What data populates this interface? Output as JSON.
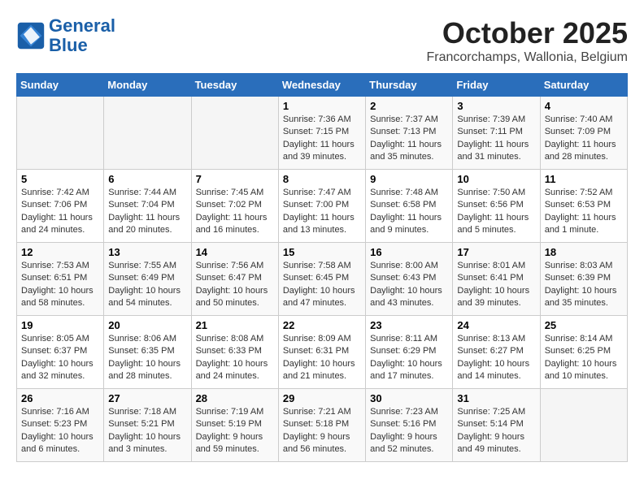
{
  "header": {
    "logo_line1": "General",
    "logo_line2": "Blue",
    "month": "October 2025",
    "location": "Francorchamps, Wallonia, Belgium"
  },
  "weekdays": [
    "Sunday",
    "Monday",
    "Tuesday",
    "Wednesday",
    "Thursday",
    "Friday",
    "Saturday"
  ],
  "weeks": [
    [
      {
        "day": "",
        "sunrise": "",
        "sunset": "",
        "daylight": ""
      },
      {
        "day": "",
        "sunrise": "",
        "sunset": "",
        "daylight": ""
      },
      {
        "day": "",
        "sunrise": "",
        "sunset": "",
        "daylight": ""
      },
      {
        "day": "1",
        "sunrise": "Sunrise: 7:36 AM",
        "sunset": "Sunset: 7:15 PM",
        "daylight": "Daylight: 11 hours and 39 minutes."
      },
      {
        "day": "2",
        "sunrise": "Sunrise: 7:37 AM",
        "sunset": "Sunset: 7:13 PM",
        "daylight": "Daylight: 11 hours and 35 minutes."
      },
      {
        "day": "3",
        "sunrise": "Sunrise: 7:39 AM",
        "sunset": "Sunset: 7:11 PM",
        "daylight": "Daylight: 11 hours and 31 minutes."
      },
      {
        "day": "4",
        "sunrise": "Sunrise: 7:40 AM",
        "sunset": "Sunset: 7:09 PM",
        "daylight": "Daylight: 11 hours and 28 minutes."
      }
    ],
    [
      {
        "day": "5",
        "sunrise": "Sunrise: 7:42 AM",
        "sunset": "Sunset: 7:06 PM",
        "daylight": "Daylight: 11 hours and 24 minutes."
      },
      {
        "day": "6",
        "sunrise": "Sunrise: 7:44 AM",
        "sunset": "Sunset: 7:04 PM",
        "daylight": "Daylight: 11 hours and 20 minutes."
      },
      {
        "day": "7",
        "sunrise": "Sunrise: 7:45 AM",
        "sunset": "Sunset: 7:02 PM",
        "daylight": "Daylight: 11 hours and 16 minutes."
      },
      {
        "day": "8",
        "sunrise": "Sunrise: 7:47 AM",
        "sunset": "Sunset: 7:00 PM",
        "daylight": "Daylight: 11 hours and 13 minutes."
      },
      {
        "day": "9",
        "sunrise": "Sunrise: 7:48 AM",
        "sunset": "Sunset: 6:58 PM",
        "daylight": "Daylight: 11 hours and 9 minutes."
      },
      {
        "day": "10",
        "sunrise": "Sunrise: 7:50 AM",
        "sunset": "Sunset: 6:56 PM",
        "daylight": "Daylight: 11 hours and 5 minutes."
      },
      {
        "day": "11",
        "sunrise": "Sunrise: 7:52 AM",
        "sunset": "Sunset: 6:53 PM",
        "daylight": "Daylight: 11 hours and 1 minute."
      }
    ],
    [
      {
        "day": "12",
        "sunrise": "Sunrise: 7:53 AM",
        "sunset": "Sunset: 6:51 PM",
        "daylight": "Daylight: 10 hours and 58 minutes."
      },
      {
        "day": "13",
        "sunrise": "Sunrise: 7:55 AM",
        "sunset": "Sunset: 6:49 PM",
        "daylight": "Daylight: 10 hours and 54 minutes."
      },
      {
        "day": "14",
        "sunrise": "Sunrise: 7:56 AM",
        "sunset": "Sunset: 6:47 PM",
        "daylight": "Daylight: 10 hours and 50 minutes."
      },
      {
        "day": "15",
        "sunrise": "Sunrise: 7:58 AM",
        "sunset": "Sunset: 6:45 PM",
        "daylight": "Daylight: 10 hours and 47 minutes."
      },
      {
        "day": "16",
        "sunrise": "Sunrise: 8:00 AM",
        "sunset": "Sunset: 6:43 PM",
        "daylight": "Daylight: 10 hours and 43 minutes."
      },
      {
        "day": "17",
        "sunrise": "Sunrise: 8:01 AM",
        "sunset": "Sunset: 6:41 PM",
        "daylight": "Daylight: 10 hours and 39 minutes."
      },
      {
        "day": "18",
        "sunrise": "Sunrise: 8:03 AM",
        "sunset": "Sunset: 6:39 PM",
        "daylight": "Daylight: 10 hours and 35 minutes."
      }
    ],
    [
      {
        "day": "19",
        "sunrise": "Sunrise: 8:05 AM",
        "sunset": "Sunset: 6:37 PM",
        "daylight": "Daylight: 10 hours and 32 minutes."
      },
      {
        "day": "20",
        "sunrise": "Sunrise: 8:06 AM",
        "sunset": "Sunset: 6:35 PM",
        "daylight": "Daylight: 10 hours and 28 minutes."
      },
      {
        "day": "21",
        "sunrise": "Sunrise: 8:08 AM",
        "sunset": "Sunset: 6:33 PM",
        "daylight": "Daylight: 10 hours and 24 minutes."
      },
      {
        "day": "22",
        "sunrise": "Sunrise: 8:09 AM",
        "sunset": "Sunset: 6:31 PM",
        "daylight": "Daylight: 10 hours and 21 minutes."
      },
      {
        "day": "23",
        "sunrise": "Sunrise: 8:11 AM",
        "sunset": "Sunset: 6:29 PM",
        "daylight": "Daylight: 10 hours and 17 minutes."
      },
      {
        "day": "24",
        "sunrise": "Sunrise: 8:13 AM",
        "sunset": "Sunset: 6:27 PM",
        "daylight": "Daylight: 10 hours and 14 minutes."
      },
      {
        "day": "25",
        "sunrise": "Sunrise: 8:14 AM",
        "sunset": "Sunset: 6:25 PM",
        "daylight": "Daylight: 10 hours and 10 minutes."
      }
    ],
    [
      {
        "day": "26",
        "sunrise": "Sunrise: 7:16 AM",
        "sunset": "Sunset: 5:23 PM",
        "daylight": "Daylight: 10 hours and 6 minutes."
      },
      {
        "day": "27",
        "sunrise": "Sunrise: 7:18 AM",
        "sunset": "Sunset: 5:21 PM",
        "daylight": "Daylight: 10 hours and 3 minutes."
      },
      {
        "day": "28",
        "sunrise": "Sunrise: 7:19 AM",
        "sunset": "Sunset: 5:19 PM",
        "daylight": "Daylight: 9 hours and 59 minutes."
      },
      {
        "day": "29",
        "sunrise": "Sunrise: 7:21 AM",
        "sunset": "Sunset: 5:18 PM",
        "daylight": "Daylight: 9 hours and 56 minutes."
      },
      {
        "day": "30",
        "sunrise": "Sunrise: 7:23 AM",
        "sunset": "Sunset: 5:16 PM",
        "daylight": "Daylight: 9 hours and 52 minutes."
      },
      {
        "day": "31",
        "sunrise": "Sunrise: 7:25 AM",
        "sunset": "Sunset: 5:14 PM",
        "daylight": "Daylight: 9 hours and 49 minutes."
      },
      {
        "day": "",
        "sunrise": "",
        "sunset": "",
        "daylight": ""
      }
    ]
  ]
}
